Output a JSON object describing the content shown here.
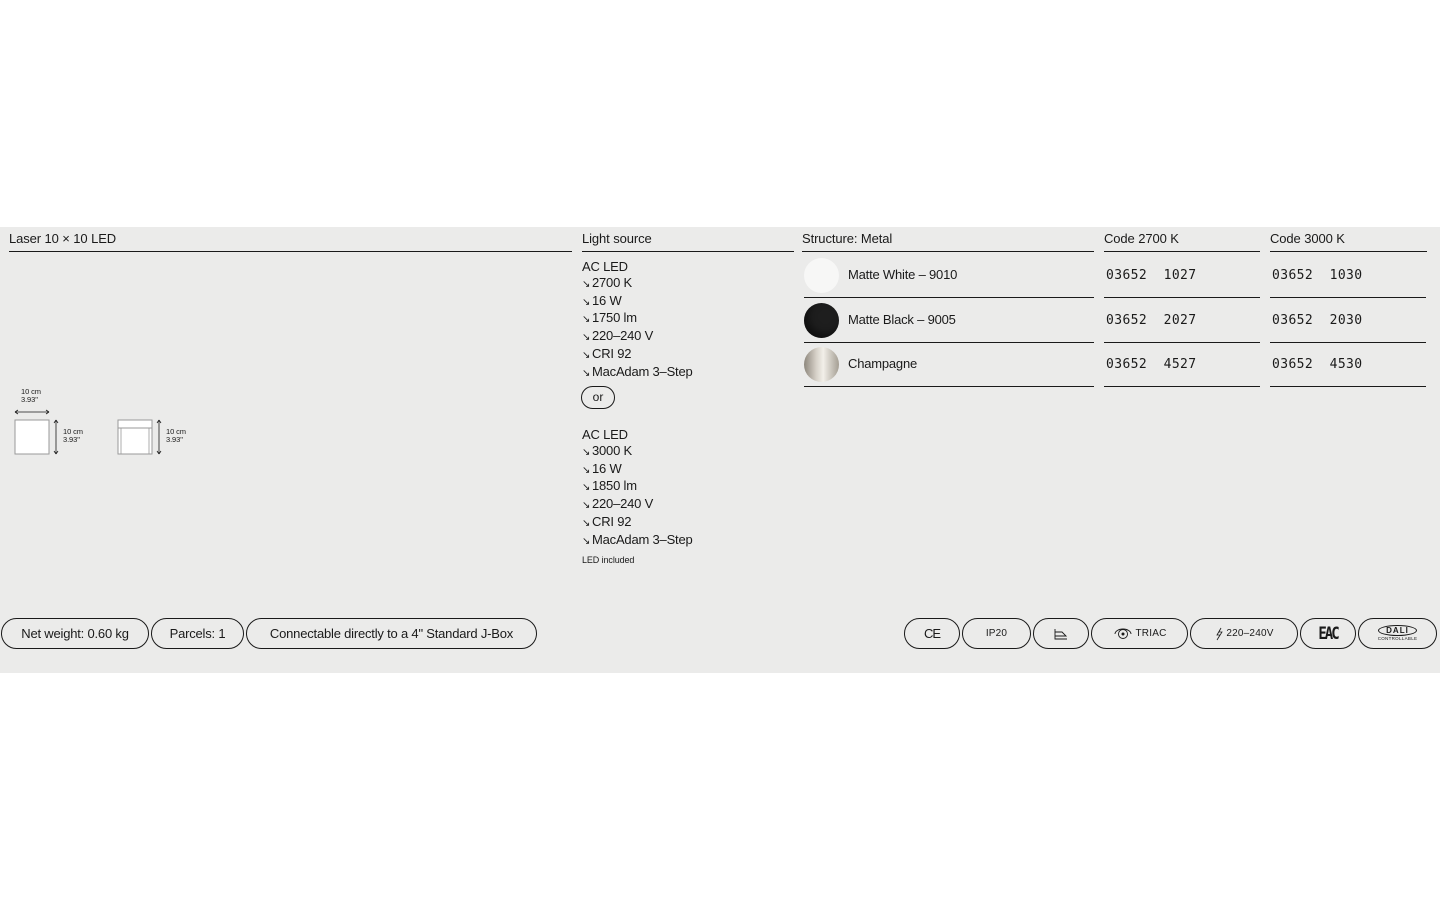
{
  "product": {
    "name": "Laser 10 × 10 LED"
  },
  "dimensions": {
    "width_label": [
      "10 cm",
      "3.93\""
    ],
    "height_label_front": [
      "10 cm",
      "3.93\""
    ],
    "height_label_side": [
      "10 cm",
      "3.93\""
    ]
  },
  "light_source": {
    "heading": "Light source",
    "option_1": {
      "type": "AC LED",
      "specs": [
        "2700 K",
        "16 W",
        "1750 lm",
        "220–240 V",
        "CRI 92",
        "MacAdam 3–Step"
      ]
    },
    "separator": "or",
    "option_2": {
      "type": "AC LED",
      "specs": [
        "3000 K",
        "16 W",
        "1850 lm",
        "220–240 V",
        "CRI 92",
        "MacAdam 3–Step"
      ]
    },
    "note": "LED included",
    "arrow_glyph": "↘"
  },
  "structure": {
    "heading": "Structure: Metal",
    "finishes": [
      {
        "label": "Matte White – 9010",
        "color": "#f7f7f6"
      },
      {
        "label": "Matte Black – 9005",
        "color": "#1e1e1e"
      },
      {
        "label": "Champagne",
        "color": "#b9b3a8"
      }
    ]
  },
  "codes_2700": {
    "heading": "Code 2700 K",
    "values": [
      "03652  1027",
      "03652  2027",
      "03652  4527"
    ]
  },
  "codes_3000": {
    "heading": "Code 3000 K",
    "values": [
      "03652  1030",
      "03652  2030",
      "03652  4530"
    ]
  },
  "footer": {
    "net_weight": "Net weight: 0.60 kg",
    "parcels": "Parcels: 1",
    "jbox": "Connectable directly to a 4\" Standard J-Box"
  },
  "certifications": {
    "ce": "CE",
    "ip": "IP20",
    "triac": "TRIAC",
    "voltage": "220–240V",
    "eac": "EAC",
    "dali": "DALI",
    "dali_sub": "CONTROLLABLE",
    "icons": [
      "ce-mark-icon",
      "ip20-icon",
      "surface-mount-icon",
      "triac-dimmable-icon",
      "voltage-icon",
      "eac-mark-icon",
      "dali-icon"
    ]
  }
}
